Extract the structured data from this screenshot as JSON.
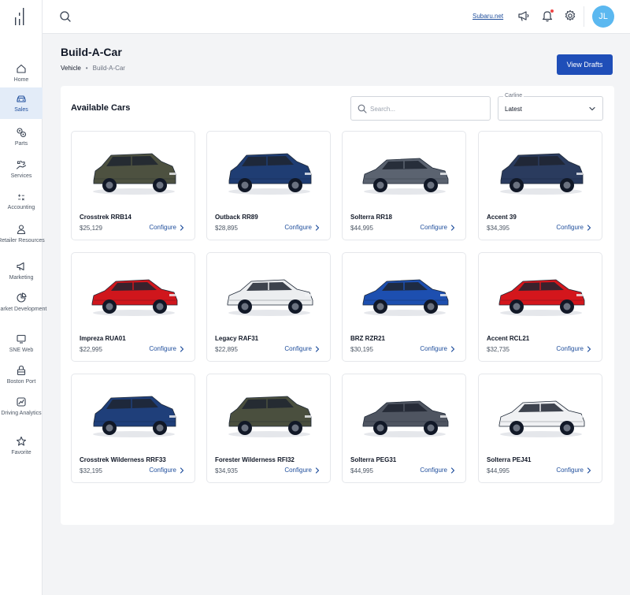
{
  "sidebar": {
    "items": [
      {
        "label": "Home",
        "icon": "home-icon"
      },
      {
        "label": "Sales",
        "icon": "car-icon",
        "active": true
      },
      {
        "label": "Parts",
        "icon": "gears-icon"
      },
      {
        "label": "Services",
        "icon": "wrench-hand-icon"
      },
      {
        "label": "Accounting",
        "icon": "calculator-icon"
      },
      {
        "label": "Retailer Resources",
        "icon": "person-icon"
      },
      {
        "label": "Marketing",
        "icon": "megaphone-icon"
      },
      {
        "label": "Market Development",
        "icon": "pie-chart-icon"
      },
      {
        "label": "SNE Web",
        "icon": "monitor-icon"
      },
      {
        "label": "Boston Port",
        "icon": "lock-box-icon"
      },
      {
        "label": "Driving Analytics",
        "icon": "trend-icon"
      },
      {
        "label": "Favorite",
        "icon": "star-icon"
      }
    ]
  },
  "topbar": {
    "link": "Subaru.net",
    "avatar_initials": "JL"
  },
  "header": {
    "title": "Build-A-Car",
    "breadcrumb": [
      "Vehicle",
      "Build-A-Car"
    ],
    "view_drafts": "View Drafts"
  },
  "main": {
    "section_title": "Available Cars",
    "search_placeholder": "Search...",
    "carline_label": "Carline",
    "carline_value": "Latest",
    "configure_label": "Configure",
    "cars": [
      {
        "name": "Crosstrek RRB14",
        "price": "$25,129",
        "color": "#4d5140"
      },
      {
        "name": "Outback RR89",
        "price": "$28,895",
        "color": "#1f3d73"
      },
      {
        "name": "Solterra RR18",
        "price": "$44,995",
        "color": "#5b6370"
      },
      {
        "name": "Accent 39",
        "price": "$34,395",
        "color": "#2a3b5e"
      },
      {
        "name": "Impreza RUA01",
        "price": "$22,995",
        "color": "#d0161c"
      },
      {
        "name": "Legacy RAF31",
        "price": "$22,895",
        "color": "#eceef0"
      },
      {
        "name": "BRZ RZR21",
        "price": "$30,195",
        "color": "#1d4fb0"
      },
      {
        "name": "Accent RCL21",
        "price": "$32,735",
        "color": "#d4161c"
      },
      {
        "name": "Crosstrek Wilderness RRF33",
        "price": "$32,195",
        "color": "#1f3f7a"
      },
      {
        "name": "Forester Wilderness RFI32",
        "price": "$34,935",
        "color": "#4a4f3e"
      },
      {
        "name": "Solterra PEG31",
        "price": "$44,995",
        "color": "#4f5561"
      },
      {
        "name": "Solterra PEJ41",
        "price": "$44,995",
        "color": "#f0f1f3"
      }
    ]
  }
}
